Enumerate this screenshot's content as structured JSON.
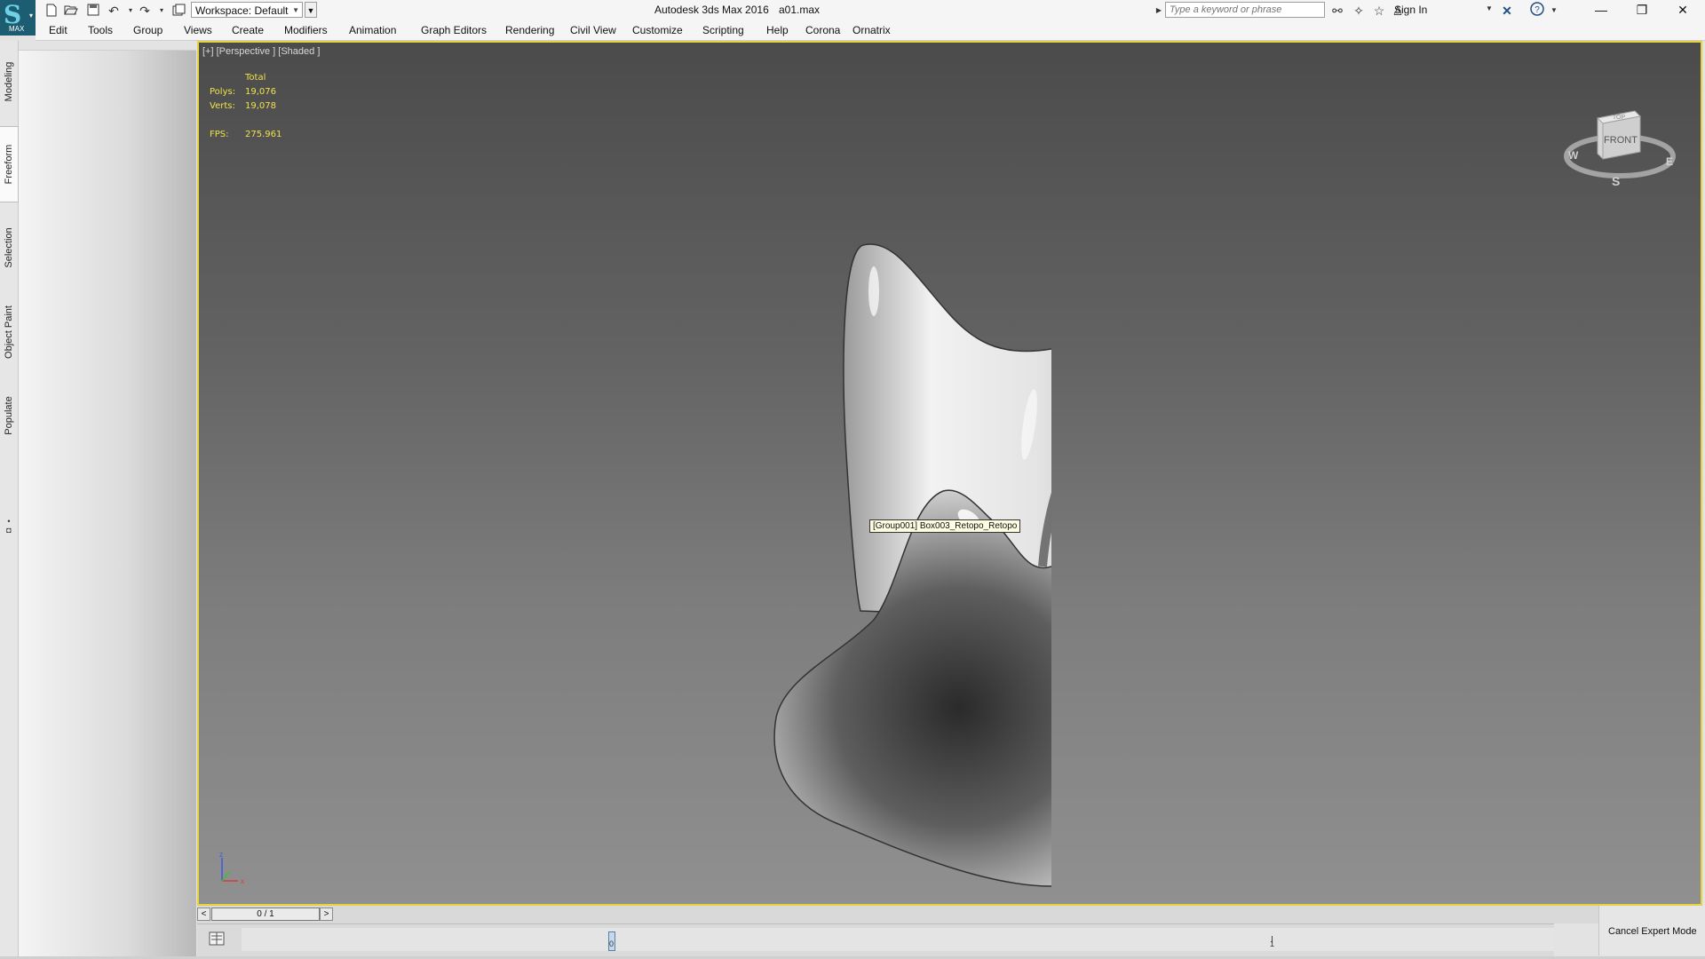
{
  "titlebar": {
    "logo_label": "MAX",
    "workspace": "Workspace: Default",
    "app_title": "Autodesk 3ds Max 2016",
    "file_title": "a01.max",
    "search_placeholder": "Type a keyword or phrase",
    "sign_in": "Sign In",
    "icons": [
      "new-file-icon",
      "open-file-icon",
      "save-icon",
      "undo-icon",
      "redo-icon",
      "project-folder-icon",
      "binoculars-icon",
      "subscription-icon",
      "favorites-star-icon",
      "user-icon",
      "exchange-x-icon",
      "help-icon"
    ],
    "window_buttons": {
      "minimize": "—",
      "restore": "❐",
      "close": "✕"
    }
  },
  "menu": [
    "Edit",
    "Tools",
    "Group",
    "Views",
    "Create",
    "Modifiers",
    "Animation",
    "Graph Editors",
    "Rendering",
    "Civil View",
    "Customize",
    "Scripting",
    "Help",
    "Corona",
    "Ornatrix"
  ],
  "ribbon_tabs": [
    "Modeling",
    "Freeform",
    "Selection",
    "Object Paint",
    "Populate"
  ],
  "ribbon_active": "Freeform",
  "viewport": {
    "label": "[+] [Perspective ] [Shaded ]",
    "stats": {
      "header": "Total",
      "polys_label": "Polys:",
      "polys_value": "19,076",
      "verts_label": "Verts:",
      "verts_value": "19,078",
      "fps_label": "FPS:",
      "fps_value": "275.961"
    },
    "tooltip": "[Group001] Box003_Retopo_Retopo",
    "viewcube": {
      "face": "FRONT",
      "top": "TOP",
      "west": "W",
      "east": "E",
      "south": "S"
    },
    "axis": {
      "x": "x",
      "z": "z"
    },
    "border_color": "#e6d23c"
  },
  "timeline": {
    "prev": "<",
    "next": ">",
    "frame_display": "0 / 1",
    "marker_label": "0",
    "end_label": "1"
  },
  "expert_mode": "Cancel Expert Mode"
}
